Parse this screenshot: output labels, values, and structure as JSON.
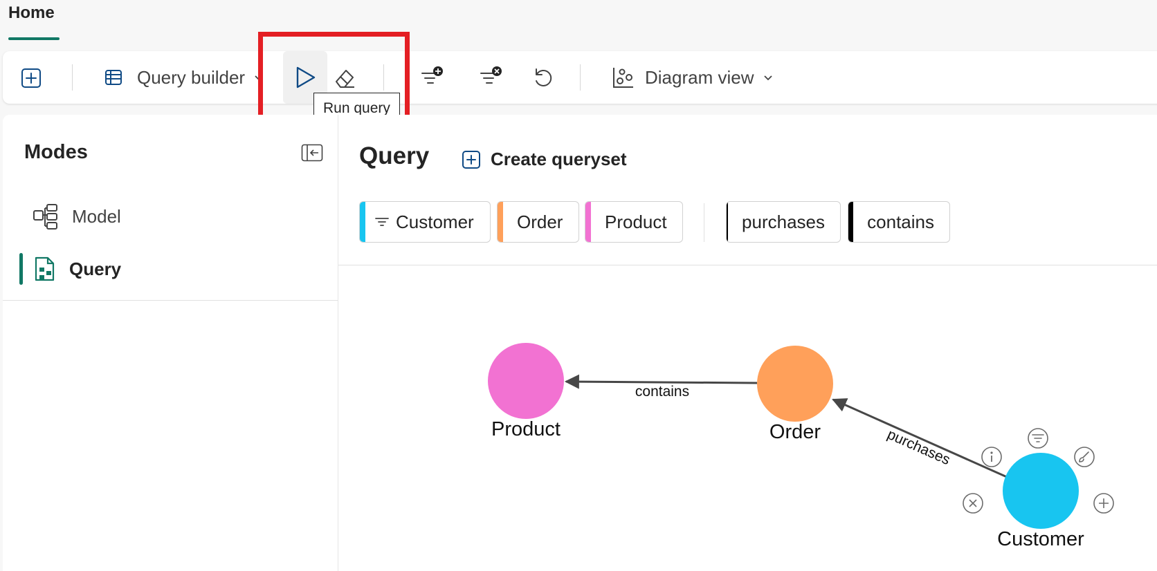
{
  "header": {
    "tab_home": "Home"
  },
  "toolbar": {
    "query_builder_label": "Query builder",
    "diagram_view_label": "Diagram view",
    "tooltip": "Run query"
  },
  "modes": {
    "title": "Modes",
    "items": [
      {
        "label": "Model",
        "selected": false
      },
      {
        "label": "Query",
        "selected": true
      }
    ]
  },
  "main": {
    "title": "Query",
    "create_queryset_label": "Create queryset",
    "node_chips": [
      {
        "label": "Customer",
        "color": "#18c5f0",
        "filtered": true
      },
      {
        "label": "Order",
        "color": "#ffa05a",
        "filtered": false
      },
      {
        "label": "Product",
        "color": "#f272d2",
        "filtered": false
      }
    ],
    "edge_chips": [
      {
        "label": "purchases",
        "color": "#000000"
      },
      {
        "label": "contains",
        "color": "#000000"
      }
    ]
  },
  "graph": {
    "nodes": [
      {
        "label": "Product",
        "color": "#f272d2"
      },
      {
        "label": "Order",
        "color": "#ffa05a"
      },
      {
        "label": "Customer",
        "color": "#18c5f0"
      }
    ],
    "edges": [
      {
        "label": "contains",
        "from": "Order",
        "to": "Product"
      },
      {
        "label": "purchases",
        "from": "Customer",
        "to": "Order"
      }
    ],
    "node_actions": [
      "info-icon",
      "filter-icon",
      "brush-icon",
      "remove-icon",
      "add-icon"
    ]
  },
  "colors": {
    "accent": "#117865",
    "highlight": "#e41f24",
    "icon_blue": "#0f4a85"
  }
}
